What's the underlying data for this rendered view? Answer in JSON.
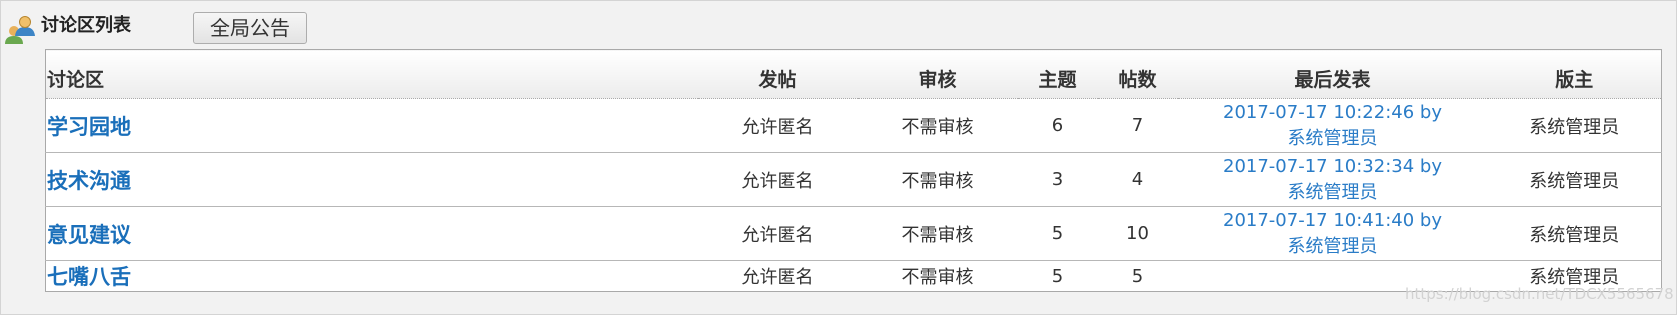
{
  "header": {
    "title": "讨论区列表",
    "announcement_button": "全局公告"
  },
  "table": {
    "columns": [
      "讨论区",
      "发帖",
      "审核",
      "主题",
      "帖数",
      "最后发表",
      "版主"
    ],
    "rows": [
      {
        "name": "学习园地",
        "post_mode": "允许匿名",
        "review": "不需审核",
        "topics": "6",
        "posts": "7",
        "last_post_time": "2017-07-17 10:22:46 by",
        "last_post_user": "系统管理员",
        "moderator": "系统管理员"
      },
      {
        "name": "技术沟通",
        "post_mode": "允许匿名",
        "review": "不需审核",
        "topics": "3",
        "posts": "4",
        "last_post_time": "2017-07-17 10:32:34 by",
        "last_post_user": "系统管理员",
        "moderator": "系统管理员"
      },
      {
        "name": "意见建议",
        "post_mode": "允许匿名",
        "review": "不需审核",
        "topics": "5",
        "posts": "10",
        "last_post_time": "2017-07-17 10:41:40 by",
        "last_post_user": "系统管理员",
        "moderator": "系统管理员"
      },
      {
        "name": "七嘴八舌",
        "post_mode": "允许匿名",
        "review": "不需审核",
        "topics": "5",
        "posts": "5",
        "last_post_time": "",
        "last_post_user": "",
        "moderator": "系统管理员"
      }
    ]
  },
  "watermark": "https://blog.csdn.net/TDCX5565678",
  "colors": {
    "link": "#1a6fba",
    "last_post_link": "#2a7cc7",
    "background": "#f2f2f2"
  },
  "icons": {
    "app": "users-group-icon"
  }
}
